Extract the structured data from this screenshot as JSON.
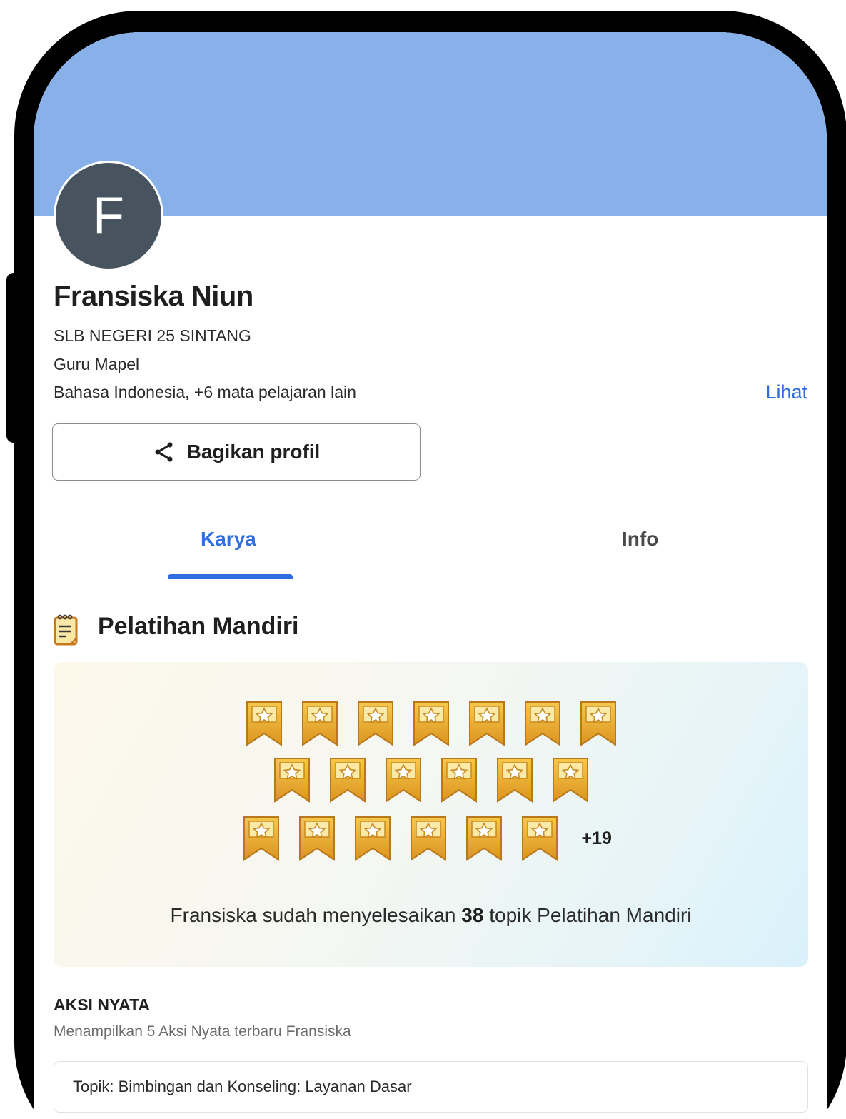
{
  "colors": {
    "cover": "#87b1e8",
    "accent": "#2f6de1",
    "avatar_bg": "#47545f",
    "badge_gold": "#e6a92b"
  },
  "profile": {
    "avatar_letter": "F",
    "name": "Fransiska Niun",
    "school": "SLB NEGERI 25 SINTANG",
    "role": "Guru Mapel",
    "subjects": "Bahasa Indonesia, +6 mata pelajaran lain",
    "see_link": "Lihat",
    "share_label": "Bagikan profil",
    "share_icon": "share-icon"
  },
  "tabs": [
    {
      "label": "Karya",
      "active": true
    },
    {
      "label": "Info",
      "active": false
    }
  ],
  "self_training": {
    "icon": "notebook-icon",
    "title": "Pelatihan Mandiri",
    "badge_rows": [
      7,
      6,
      6
    ],
    "more_label": "+19",
    "summary_prefix": "Fransiska sudah menyelesaikan ",
    "summary_count": "38",
    "summary_suffix": " topik Pelatihan Mandiri"
  },
  "aksi_nyata": {
    "title": "AKSI NYATA",
    "subtitle": "Menampilkan 5 Aksi Nyata terbaru Fransiska",
    "items": [
      {
        "label": "Topik: Bimbingan dan Konseling: Layanan Dasar"
      }
    ]
  }
}
